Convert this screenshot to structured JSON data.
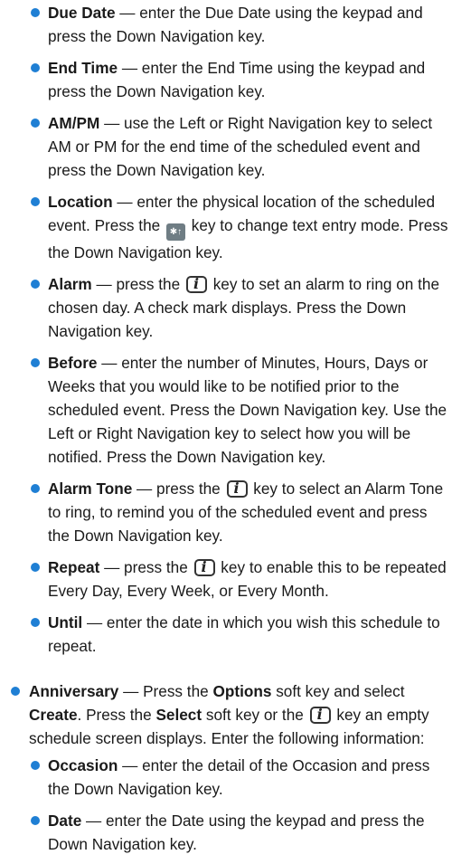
{
  "section1": {
    "items": [
      {
        "term": "Due Date",
        "text": " — enter the Due Date using the keypad and press the Down Navigation key."
      },
      {
        "term": "End Time",
        "text": " — enter the End Time using the keypad and press the Down Navigation key."
      },
      {
        "term": "AM/PM",
        "text": " — use the Left or Right Navigation key to select AM or PM for the end time of the scheduled event and press the Down Navigation key."
      },
      {
        "term": "Location",
        "text_a": " — enter the physical location of the scheduled event.  Press the ",
        "text_b": " key to change text entry mode. Press the Down Navigation key."
      },
      {
        "term": "Alarm",
        "text_a": " — press the ",
        "text_b": " key to set an alarm to ring on the chosen day. A check mark displays. Press the Down Navigation key."
      },
      {
        "term": "Before",
        "text": " — enter the number of Minutes, Hours, Days or Weeks that you would like to be notified prior to the scheduled event. Press the Down Navigation key. Use the Left or Right Navigation key to select how you will be notified. Press the Down Navigation key."
      },
      {
        "term": "Alarm Tone",
        "text_a": " — press the ",
        "text_b": " key to select an Alarm Tone to ring, to remind you of the scheduled event and press the Down Navigation key."
      },
      {
        "term": "Repeat",
        "text_a": " — press the ",
        "text_b": " key to enable this to be repeated Every Day, Every Week, or Every Month."
      },
      {
        "term": "Until",
        "text": " — enter the date in which you wish this schedule to repeat."
      }
    ]
  },
  "anniversary": {
    "term": "Anniversary",
    "t1": " — Press the ",
    "b1": "Options",
    "t2": " soft key and select ",
    "b2": "Create",
    "t3": ". Press the ",
    "b3": "Select",
    "t4": " soft key or the ",
    "t5": " key an empty schedule screen displays. Enter the following information:",
    "items": [
      {
        "term": "Occasion",
        "text": " — enter the detail of the Occasion and press the Down Navigation key."
      },
      {
        "term": "Date",
        "text": " — enter the Date using the keypad and press the Down Navigation key."
      }
    ]
  },
  "icons": {
    "ok_key": "i-key-icon",
    "star_key": "star-key-icon"
  },
  "colors": {
    "bullet": "#1f7fd4"
  }
}
